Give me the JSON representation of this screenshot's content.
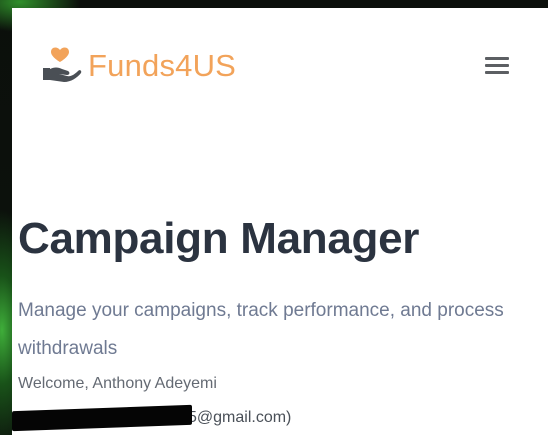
{
  "header": {
    "brand_name": "Funds4US",
    "logo_icon": "heart-in-hand-icon",
    "menu_icon": "hamburger-menu-icon",
    "brand_color": "#f2a35a"
  },
  "main": {
    "title": "Campaign Manager",
    "subtitle": "Manage your campaigns, track performance, and process withdrawals",
    "welcome": "Welcome, Anthony Adeyemi",
    "email_visible": "5@gmail.com)"
  },
  "colors": {
    "title": "#2b3340",
    "subtitle": "#6f7a92",
    "background": "#ffffff"
  }
}
